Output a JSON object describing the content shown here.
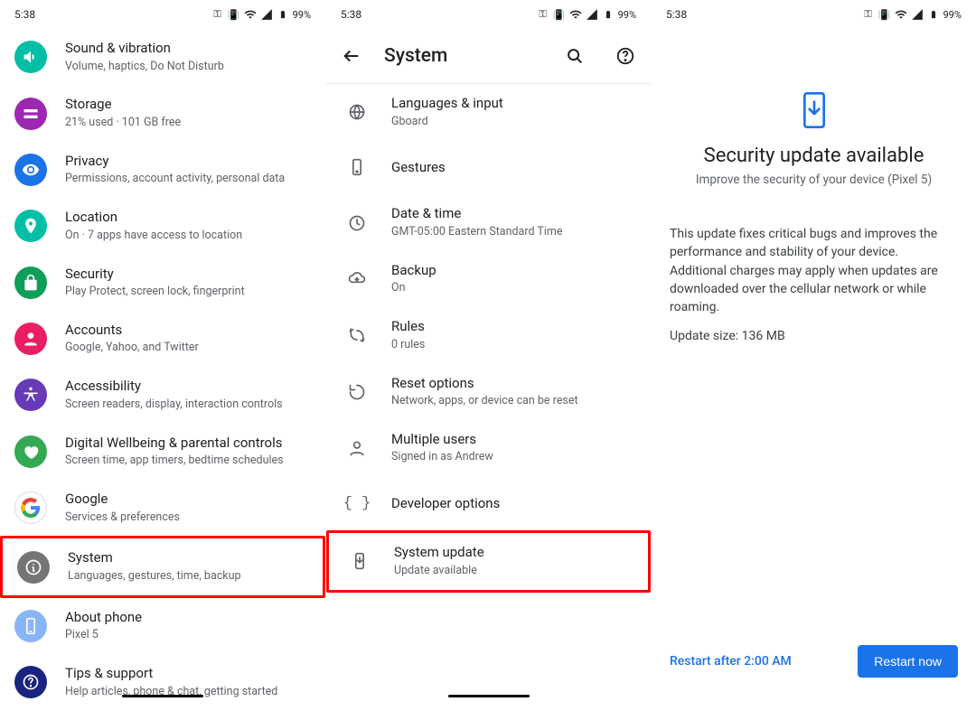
{
  "status": {
    "time": "5:38",
    "battery": "99%"
  },
  "screen1": {
    "items": [
      {
        "title": "Sound & vibration",
        "sub": "Volume, haptics, Do Not Disturb",
        "color": "c-teal",
        "icon": "volume-icon"
      },
      {
        "title": "Storage",
        "sub": "21% used · 101 GB free",
        "color": "c-purple",
        "icon": "storage-icon"
      },
      {
        "title": "Privacy",
        "sub": "Permissions, account activity, personal data",
        "color": "c-blue",
        "icon": "eye-icon"
      },
      {
        "title": "Location",
        "sub": "On · 7 apps have access to location",
        "color": "c-teal",
        "icon": "location-icon"
      },
      {
        "title": "Security",
        "sub": "Play Protect, screen lock, fingerprint",
        "color": "c-dgreen",
        "icon": "lock-icon"
      },
      {
        "title": "Accounts",
        "sub": "Google, Yahoo, and Twitter",
        "color": "c-pink",
        "icon": "account-icon"
      },
      {
        "title": "Accessibility",
        "sub": "Screen readers, display, interaction controls",
        "color": "c-violet",
        "icon": "accessibility-icon"
      },
      {
        "title": "Digital Wellbeing & parental controls",
        "sub": "Screen time, app timers, bedtime schedules",
        "color": "c-lime",
        "icon": "wellbeing-icon"
      },
      {
        "title": "Google",
        "sub": "Services & preferences",
        "color": "c-white",
        "icon": "google-icon"
      },
      {
        "title": "System",
        "sub": "Languages, gestures, time, backup",
        "color": "c-grey",
        "icon": "info-icon",
        "hl": true
      },
      {
        "title": "About phone",
        "sub": "Pixel 5",
        "color": "c-lblue",
        "icon": "phone-icon"
      },
      {
        "title": "Tips & support",
        "sub": "Help articles, phone & chat, getting started",
        "color": "c-dblue",
        "icon": "help-icon"
      }
    ]
  },
  "screen2": {
    "title": "System",
    "items": [
      {
        "title": "Languages & input",
        "sub": "Gboard",
        "icon": "globe-icon"
      },
      {
        "title": "Gestures",
        "sub": "",
        "icon": "gesture-icon"
      },
      {
        "title": "Date & time",
        "sub": "GMT-05:00 Eastern Standard Time",
        "icon": "clock-icon"
      },
      {
        "title": "Backup",
        "sub": "On",
        "icon": "cloud-icon"
      },
      {
        "title": "Rules",
        "sub": "0 rules",
        "icon": "rules-icon"
      },
      {
        "title": "Reset options",
        "sub": "Network, apps, or device can be reset",
        "icon": "reset-icon"
      },
      {
        "title": "Multiple users",
        "sub": "Signed in as Andrew",
        "icon": "user-icon"
      },
      {
        "title": "Developer options",
        "sub": "",
        "icon": "braces-icon"
      },
      {
        "title": "System update",
        "sub": "Update available",
        "icon": "update-icon",
        "hl": true
      }
    ]
  },
  "screen3": {
    "title": "Security update available",
    "sub": "Improve the security of your device (Pixel 5)",
    "body": "This update fixes critical bugs and improves the performance and stability of your device. Additional charges may apply when updates are downloaded over the cellular network or while roaming.",
    "size": "Update size: 136 MB",
    "restart_after": "Restart after 2:00 AM",
    "restart_now": "Restart now"
  }
}
